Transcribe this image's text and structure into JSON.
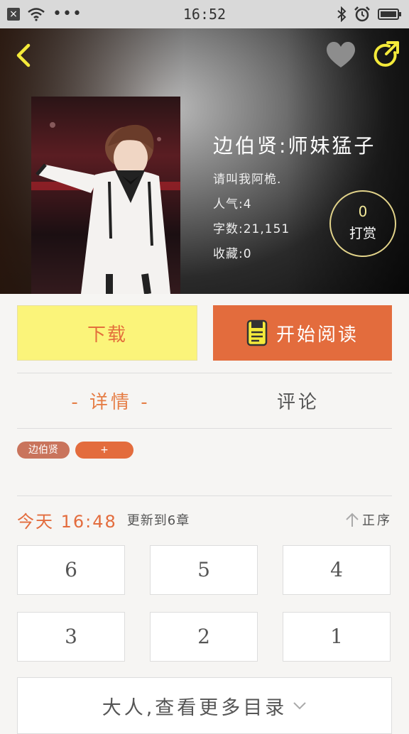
{
  "status_bar": {
    "time": "16:52",
    "close_box": "×",
    "dots": "•••"
  },
  "book": {
    "title": "边伯贤:师妹猛子",
    "subtitle": "请叫我阿桅.",
    "popularity": "人气:4",
    "word_count": "字数:21,151",
    "favorites": "收藏:0"
  },
  "tip": {
    "count": "0",
    "label": "打赏"
  },
  "actions": {
    "download": "下载",
    "read": "开始阅读"
  },
  "tabs": {
    "details": "- 详情 -",
    "comments": "评论"
  },
  "tags": [
    "边伯贤",
    "+"
  ],
  "update": {
    "date": "今天 16:48",
    "text": "更新到6章",
    "sort": "正序"
  },
  "chapters": [
    "6",
    "5",
    "4",
    "3",
    "2",
    "1"
  ],
  "more_catalog": "大人,查看更多目录",
  "colors": {
    "accent": "#e36c3d",
    "download_bg": "#fbf47a",
    "icon_yellow": "#f4ea3a"
  },
  "icons": [
    "back-arrow-icon",
    "heart-icon",
    "share-icon",
    "book-icon",
    "sort-up-arrow-icon",
    "chevron-down-icon",
    "wifi-icon",
    "bluetooth-icon",
    "alarm-icon",
    "battery-icon"
  ]
}
